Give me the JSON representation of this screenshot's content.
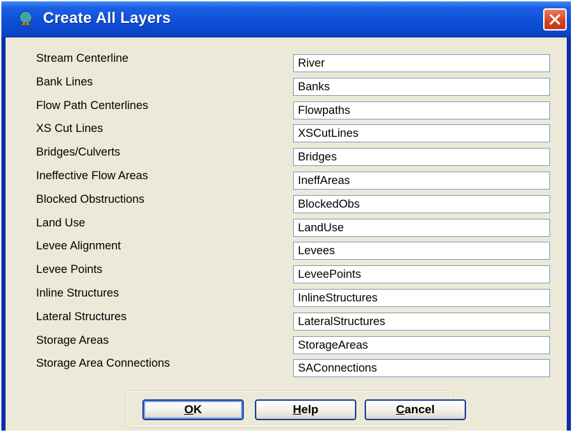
{
  "window": {
    "title": "Create All Layers",
    "icon": "globe-icon",
    "close_icon": "close-x-icon"
  },
  "layers": [
    {
      "label": "Stream Centerline",
      "value": "River"
    },
    {
      "label": "Bank Lines",
      "value": "Banks"
    },
    {
      "label": "Flow Path Centerlines",
      "value": "Flowpaths"
    },
    {
      "label": "XS Cut Lines",
      "value": "XSCutLines"
    },
    {
      "label": "Bridges/Culverts",
      "value": "Bridges"
    },
    {
      "label": "Ineffective Flow Areas",
      "value": "IneffAreas"
    },
    {
      "label": "Blocked Obstructions",
      "value": "BlockedObs"
    },
    {
      "label": "Land Use",
      "value": "LandUse"
    },
    {
      "label": "Levee Alignment",
      "value": "Levees"
    },
    {
      "label": "Levee Points",
      "value": "LeveePoints"
    },
    {
      "label": "Inline Structures",
      "value": "InlineStructures"
    },
    {
      "label": "Lateral Structures",
      "value": "LateralStructures"
    },
    {
      "label": "Storage Areas",
      "value": "StorageAreas"
    },
    {
      "label": "Storage Area Connections",
      "value": "SAConnections"
    }
  ],
  "buttons": {
    "ok": {
      "accel": "O",
      "rest": "K"
    },
    "help": {
      "accel": "H",
      "rest": "elp"
    },
    "cancel": {
      "accel": "C",
      "rest": "ancel"
    }
  },
  "colors": {
    "titlebar": "#0b4fd8",
    "close": "#d2431d",
    "client_bg": "#ece9d8",
    "field_border": "#7f9db9"
  }
}
